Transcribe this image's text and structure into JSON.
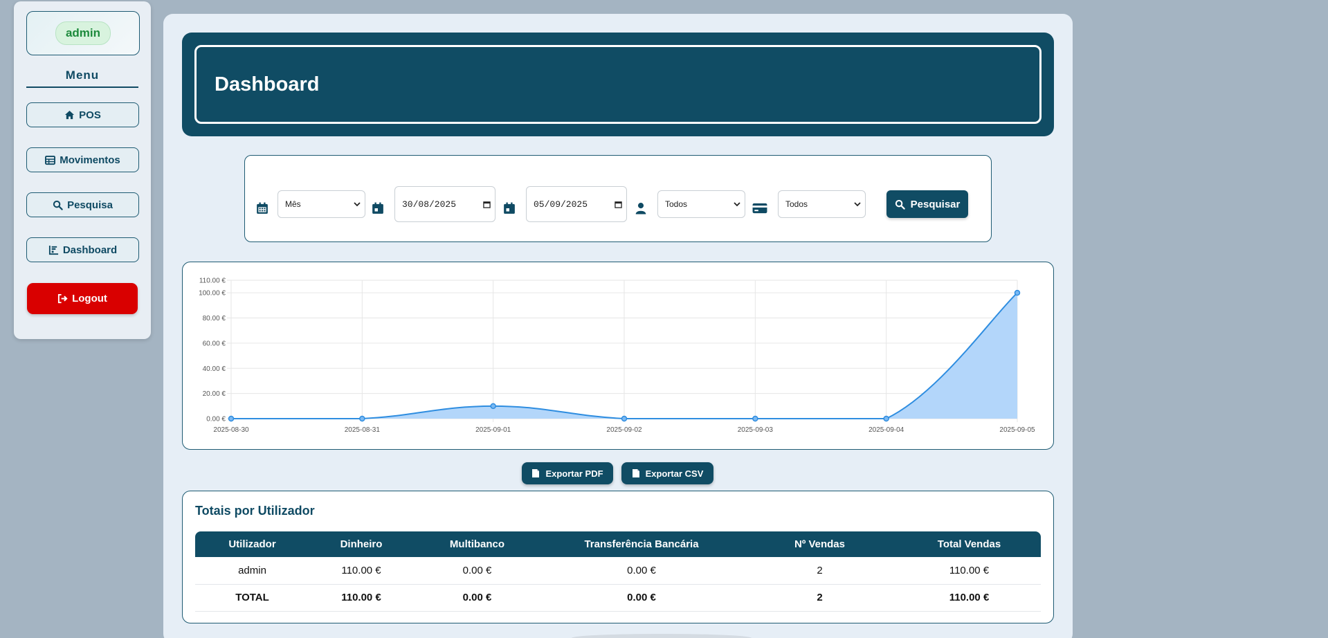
{
  "sidebar": {
    "user": "admin",
    "menu_title": "Menu",
    "items": [
      {
        "label": "POS",
        "icon": "home-icon"
      },
      {
        "label": "Movimentos",
        "icon": "table-icon"
      },
      {
        "label": "Pesquisa",
        "icon": "search-icon"
      },
      {
        "label": "Dashboard",
        "icon": "chart-icon"
      }
    ],
    "logout_label": "Logout"
  },
  "header": {
    "title": "Dashboard"
  },
  "filters": {
    "period": "Mês",
    "date_from": "30/08/2025",
    "date_to": "05/09/2025",
    "user": "Todos",
    "payment": "Todos",
    "search_label": "Pesquisar"
  },
  "chart_data": {
    "type": "area",
    "x": [
      "2025-08-30",
      "2025-08-31",
      "2025-09-01",
      "2025-09-02",
      "2025-09-03",
      "2025-09-04",
      "2025-09-05"
    ],
    "values": [
      0,
      0,
      10,
      0,
      0,
      0,
      100
    ],
    "ylim": [
      0,
      110
    ],
    "yticks": [
      "110.00 €",
      "100.00 €",
      "80.00 €",
      "60.00 €",
      "40.00 €",
      "20.00 €",
      "0.00 €"
    ],
    "ytick_values": [
      110,
      100,
      80,
      60,
      40,
      20,
      0
    ],
    "grid": true,
    "colors": {
      "line": "#2e8de0",
      "fill": "#b3d6fa"
    }
  },
  "exports": {
    "pdf_label": "Exportar PDF",
    "csv_label": "Exportar CSV"
  },
  "totals": {
    "title": "Totais por Utilizador",
    "columns": [
      "Utilizador",
      "Dinheiro",
      "Multibanco",
      "Transferência Bancária",
      "Nº Vendas",
      "Total Vendas"
    ],
    "rows": [
      [
        "admin",
        "110.00 €",
        "0.00 €",
        "0.00 €",
        "2",
        "110.00 €"
      ]
    ],
    "total_row": [
      "TOTAL",
      "110.00 €",
      "0.00 €",
      "0.00 €",
      "2",
      "110.00 €"
    ]
  }
}
